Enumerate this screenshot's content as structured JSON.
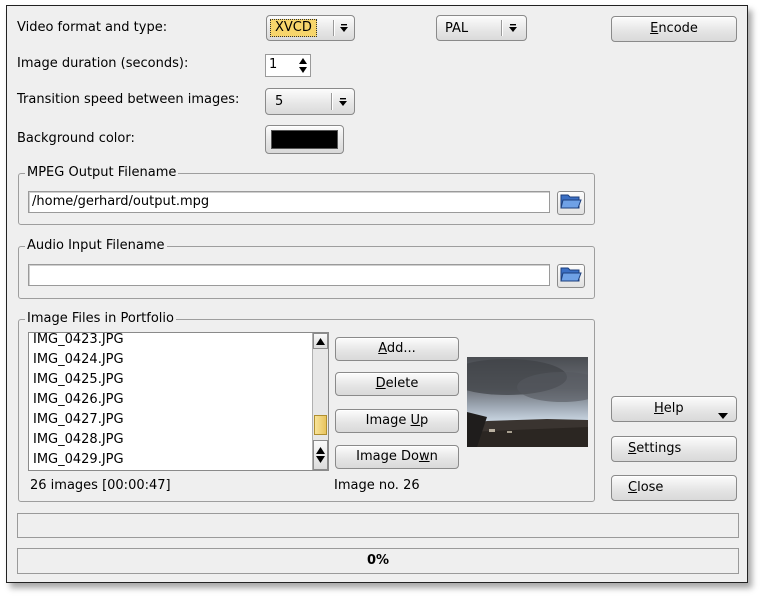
{
  "settings": {
    "video_format_label": "Video format and type:",
    "video_format_value": "XVCD",
    "video_standard_value": "PAL",
    "image_duration_label": "Image duration (seconds):",
    "image_duration_value": "1",
    "transition_speed_label": "Transition speed between images:",
    "transition_speed_value": "5",
    "background_color_label": "Background color:",
    "background_color_value": "#000000"
  },
  "buttons": {
    "encode": {
      "pre": "",
      "mnemonic": "E",
      "post": "ncode"
    },
    "help": {
      "pre": "",
      "mnemonic": "H",
      "post": "elp"
    },
    "settings": {
      "pre": "",
      "mnemonic": "S",
      "post": "ettings"
    },
    "close": {
      "pre": "",
      "mnemonic": "C",
      "post": "lose"
    }
  },
  "mpeg_output": {
    "title": "MPEG Output Filename",
    "value": "/home/gerhard/output.mpg"
  },
  "audio_input": {
    "title": "Audio Input Filename",
    "value": ""
  },
  "portfolio": {
    "title": "Image Files in Portfolio",
    "files": [
      "IMG_0423.JPG",
      "IMG_0424.JPG",
      "IMG_0425.JPG",
      "IMG_0426.JPG",
      "IMG_0427.JPG",
      "IMG_0428.JPG",
      "IMG_0429.JPG"
    ],
    "add": {
      "pre": "",
      "mnemonic": "A",
      "post": "dd..."
    },
    "delete": {
      "pre": "",
      "mnemonic": "D",
      "post": "elete"
    },
    "image_up": {
      "pre": "Image ",
      "mnemonic": "U",
      "post": "p"
    },
    "image_down": {
      "pre": "Image Do",
      "mnemonic": "w",
      "post": "n"
    },
    "summary": "26 images [00:00:47]",
    "image_no": "Image no. 26"
  },
  "status": {
    "message": "",
    "progress_text": "0%",
    "progress_fraction": 0
  },
  "icons": {
    "combo_arrow": "down-arrow-icon",
    "folder": "open-folder-icon",
    "scroll_up": "up-arrow-icon",
    "scroll_down": "down-arrow-icon",
    "help_dropdown": "caret-down-icon"
  }
}
